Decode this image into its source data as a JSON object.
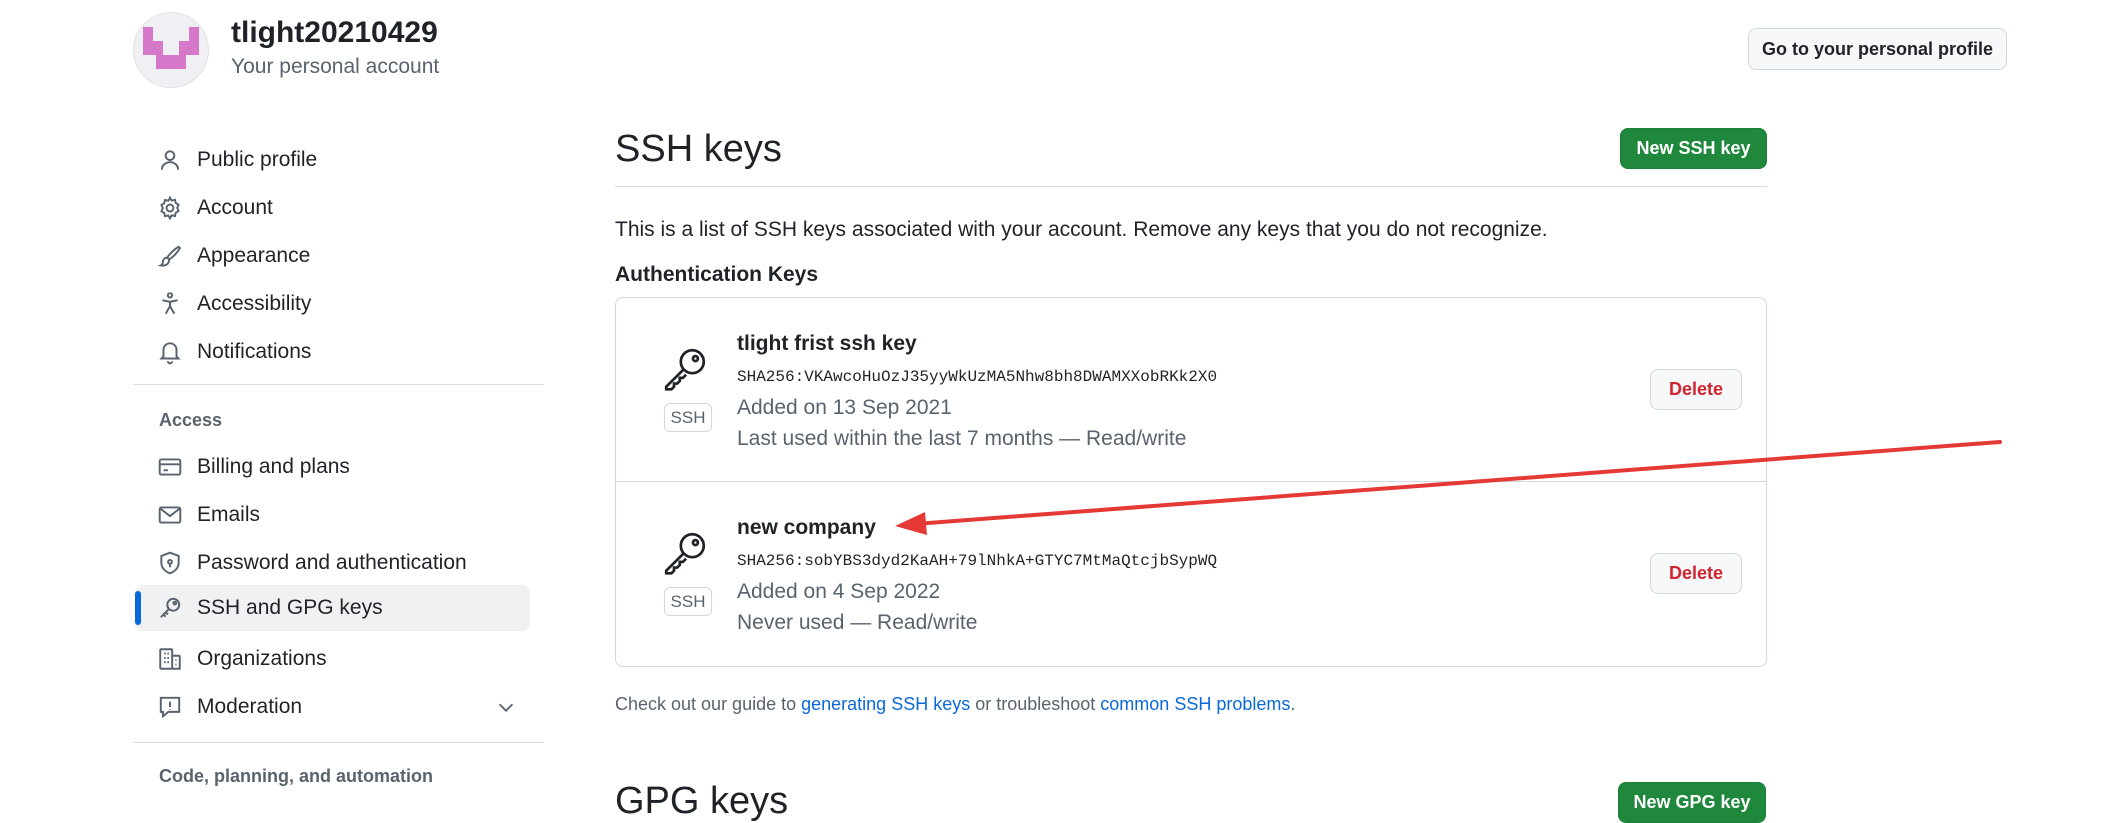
{
  "account": {
    "username": "tlight20210429",
    "subtitle": "Your personal account",
    "profile_button": "Go to your personal profile"
  },
  "sidebar": {
    "items": [
      {
        "label": "Public profile",
        "icon": "person-icon"
      },
      {
        "label": "Account",
        "icon": "gear-icon"
      },
      {
        "label": "Appearance",
        "icon": "paintbrush-icon"
      },
      {
        "label": "Accessibility",
        "icon": "accessibility-icon"
      },
      {
        "label": "Notifications",
        "icon": "bell-icon"
      }
    ],
    "access_heading": "Access",
    "access_items": [
      {
        "label": "Billing and plans",
        "icon": "credit-card-icon"
      },
      {
        "label": "Emails",
        "icon": "mail-icon"
      },
      {
        "label": "Password and authentication",
        "icon": "shield-lock-icon"
      },
      {
        "label": "SSH and GPG keys",
        "icon": "key-icon",
        "active": true
      },
      {
        "label": "Organizations",
        "icon": "organization-icon"
      },
      {
        "label": "Moderation",
        "icon": "report-icon"
      }
    ],
    "code_heading": "Code, planning, and automation"
  },
  "main": {
    "title": "SSH keys",
    "new_key_button": "New SSH key",
    "description": "This is a list of SSH keys associated with your account. Remove any keys that you do not recognize.",
    "auth_heading": "Authentication Keys",
    "keys": [
      {
        "title": "tlight frist ssh key",
        "fingerprint": "SHA256:VKAwcoHuOzJ35yyWkUzMA5Nhw8bh8DWAMXXobRKk2X0",
        "added": "Added on 13 Sep 2021",
        "usage": "Last used within the last 7 months — Read/write",
        "badge": "SSH",
        "delete_label": "Delete"
      },
      {
        "title": "new company",
        "fingerprint": "SHA256:sobYBS3dyd2KaAH+79lNhkA+GTYC7MtMaQtcjbSypWQ",
        "added": "Added on 4 Sep 2022",
        "usage": "Never used — Read/write",
        "badge": "SSH",
        "delete_label": "Delete"
      }
    ],
    "guide": {
      "prefix": "Check out our guide to ",
      "link1": "generating SSH keys",
      "middle": " or troubleshoot ",
      "link2": "common SSH problems",
      "suffix": "."
    },
    "gpg_title": "GPG keys",
    "new_gpg_button": "New GPG key"
  },
  "colors": {
    "accent": "#0969da",
    "primary_button": "#1f883d",
    "danger": "#d1242f",
    "annotation_arrow": "#e53935",
    "avatar_pattern": "#d678c9"
  }
}
